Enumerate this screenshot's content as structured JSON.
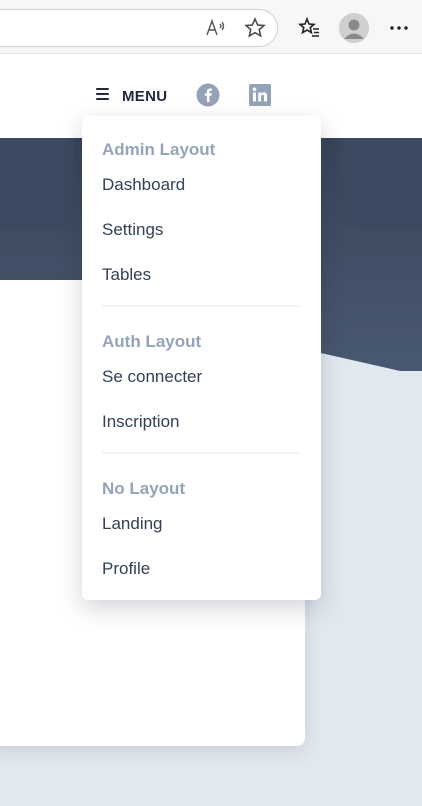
{
  "browser": {
    "icons": [
      "read-aloud-icon",
      "favorite-star-icon",
      "favorites-icon",
      "profile-avatar",
      "more-icon"
    ]
  },
  "header": {
    "menu_label": "MENU",
    "social": [
      "facebook-icon",
      "linkedin-icon"
    ]
  },
  "dropdown": {
    "sections": [
      {
        "title": "Admin Layout",
        "items": [
          "Dashboard",
          "Settings",
          "Tables"
        ]
      },
      {
        "title": "Auth Layout",
        "items": [
          "Se connecter",
          "Inscription"
        ]
      },
      {
        "title": "No Layout",
        "items": [
          "Landing",
          "Profile"
        ]
      }
    ]
  },
  "colors": {
    "hero_dark": "#374559",
    "page_bg": "#e2e8f0",
    "section_title": "#94a3b8",
    "item_text": "#334155",
    "menu_text": "#1e293b"
  }
}
